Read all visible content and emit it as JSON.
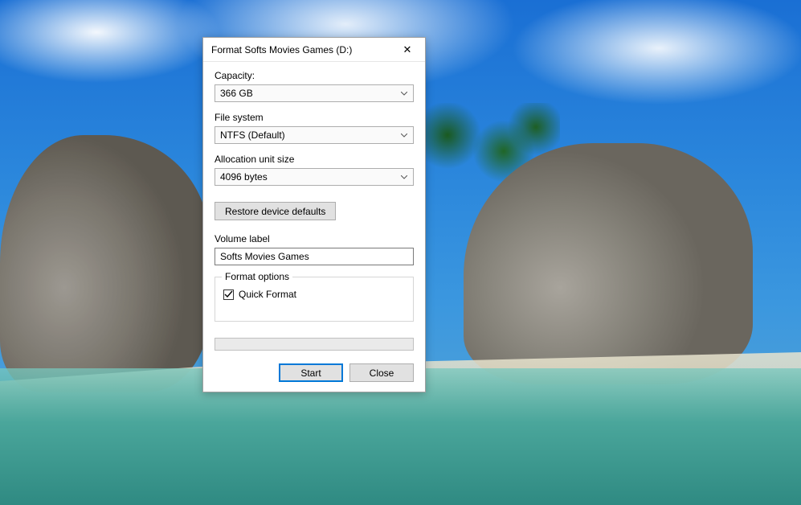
{
  "dialog": {
    "title": "Format Softs Movies Games (D:)",
    "capacity_label": "Capacity:",
    "capacity_value": "366 GB",
    "filesystem_label": "File system",
    "filesystem_value": "NTFS (Default)",
    "allocation_label": "Allocation unit size",
    "allocation_value": "4096 bytes",
    "restore_label": "Restore device defaults",
    "volume_label_label": "Volume label",
    "volume_label_value": "Softs Movies Games",
    "options_group_label": "Format options",
    "quickformat_label": "Quick Format",
    "quickformat_checked": true,
    "start_label": "Start",
    "close_label": "Close"
  }
}
